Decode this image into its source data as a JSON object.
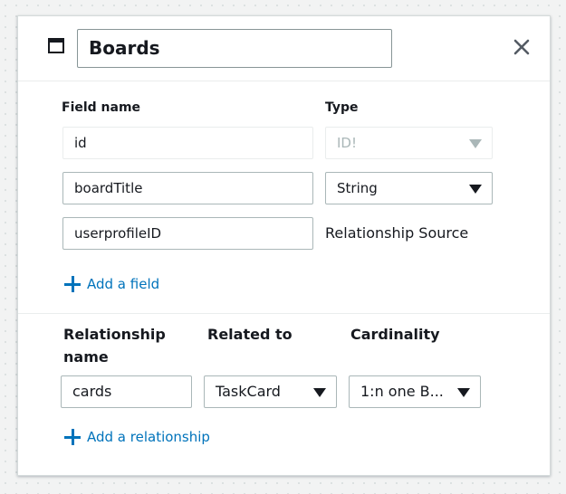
{
  "model": {
    "title": "Boards"
  },
  "fields": {
    "header_field_name": "Field name",
    "header_type": "Type",
    "rows": [
      {
        "name": "id",
        "type": "ID!"
      },
      {
        "name": "boardTitle",
        "type": "String"
      },
      {
        "name": "userprofileID",
        "type": "Relationship Source"
      }
    ],
    "add_field_label": "Add a field"
  },
  "relationships": {
    "header_name": "Relationship name",
    "header_related_to": "Related to",
    "header_cardinality": "Cardinality",
    "rows": [
      {
        "name": "cards",
        "related_to": "TaskCard",
        "cardinality": "1:n one B..."
      }
    ],
    "add_relationship_label": "Add a relationship"
  },
  "icons": {
    "window": "window-icon",
    "close": "close-icon",
    "add": "plus-icon",
    "dropdown": "caret-down-icon"
  },
  "colors": {
    "link": "#0073bb",
    "border": "#aab7b8",
    "disabled_text": "#aab7b8"
  }
}
